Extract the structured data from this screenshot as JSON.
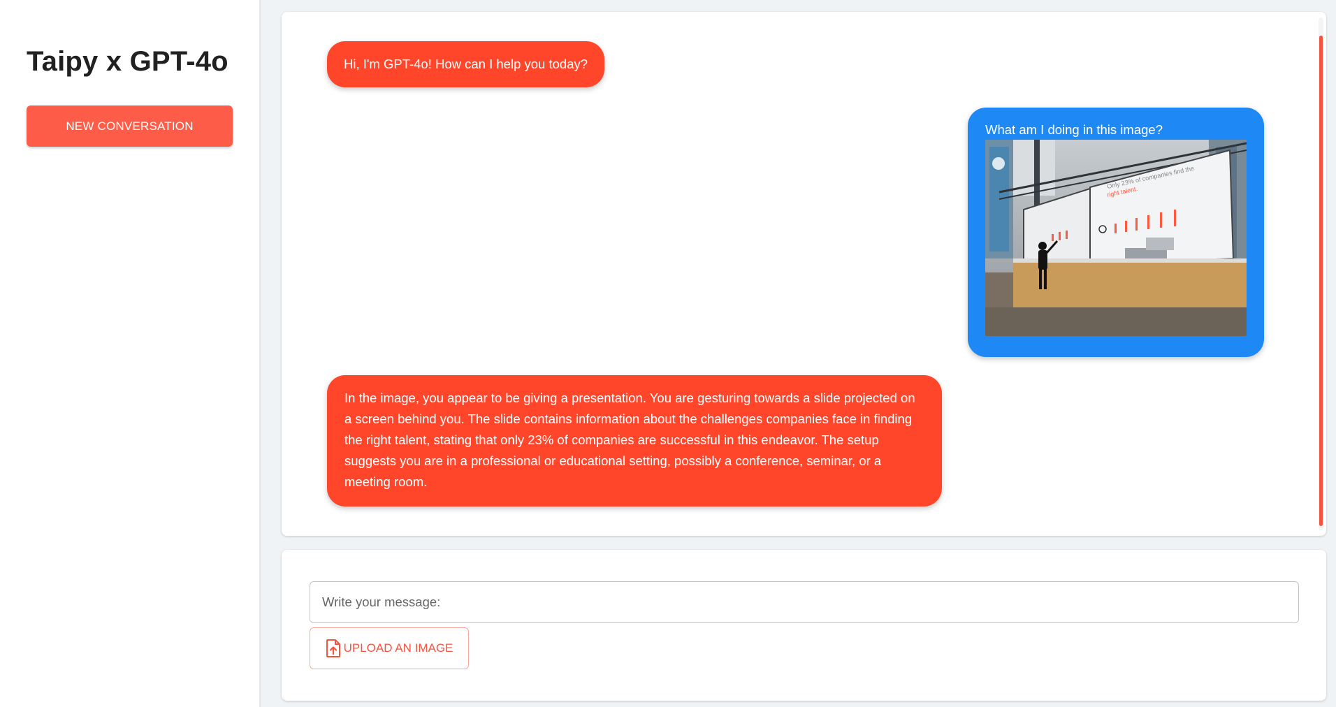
{
  "sidebar": {
    "title": "Taipy x GPT-4o",
    "new_conversation_label": "NEW CONVERSATION"
  },
  "messages": [
    {
      "role": "assistant",
      "text": "Hi, I'm GPT-4o! How can I help you today?"
    },
    {
      "role": "user",
      "text": "What am I doing in this image?",
      "image": "presentation-photo"
    },
    {
      "role": "assistant",
      "text": "In the image, you appear to be giving a presentation. You are gesturing towards a slide projected on a screen behind you. The slide contains information about the challenges companies face in finding the right talent, stating that only 23% of companies are successful in this endeavor. The setup suggests you are in a professional or educational setting, possibly a conference, seminar, or a meeting room."
    }
  ],
  "photo": {
    "slide_title": "Only 23% of companies find the right talent"
  },
  "input": {
    "placeholder": "Write your message:",
    "value": ""
  },
  "upload": {
    "label": "UPLOAD AN IMAGE",
    "icon": "file-upload-icon"
  },
  "colors": {
    "accent": "#fd5c48",
    "assistant_bubble": "#ff462b",
    "user_bubble": "#1e88f5",
    "scroll_thumb": "#f5543f"
  }
}
